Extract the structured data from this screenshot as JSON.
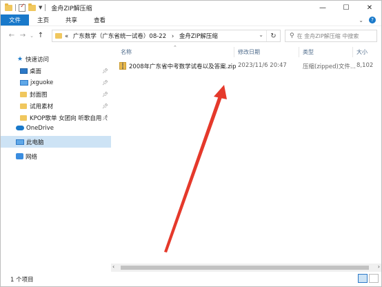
{
  "window": {
    "title": "金舟ZIP解压缩",
    "controls": {
      "minimize": "—",
      "maximize": "☐",
      "close": "✕"
    }
  },
  "ribbon": {
    "tabs": [
      "文件",
      "主页",
      "共享",
      "查看"
    ]
  },
  "address": {
    "prefix": "«",
    "path": [
      "广东数学（广东省统一试卷）08-22",
      "金舟ZIP解压缩"
    ],
    "separator": "›"
  },
  "search": {
    "placeholder": "在 金舟ZIP解压缩 中搜索"
  },
  "sidebar": {
    "quick_access": "快速访问",
    "items": [
      {
        "label": "桌面",
        "icon": "desktop-icon",
        "pinned": true
      },
      {
        "label": "jxguoke",
        "icon": "monitor-icon",
        "pinned": true
      },
      {
        "label": "封面图",
        "icon": "folder-icon",
        "pinned": true
      },
      {
        "label": "试用素材",
        "icon": "folder-icon",
        "pinned": true
      },
      {
        "label": "KPOP歌单  女团向  听歌自用（",
        "icon": "folder-icon",
        "pinned": true
      }
    ],
    "onedrive": "OneDrive",
    "this_pc": "此电脑",
    "network": "网络"
  },
  "columns": {
    "name": "名称",
    "modified": "修改日期",
    "type": "类型",
    "size": "大小"
  },
  "files": [
    {
      "name": "2008年广东省中考数学试卷以及答案.zip",
      "modified": "2023/11/6 20:47",
      "type": "压缩(zipped)文件...",
      "size": "8,102"
    }
  ],
  "status": {
    "item_count": "1 个项目"
  },
  "colors": {
    "accent": "#1979ca",
    "arrow": "#e5392b"
  }
}
